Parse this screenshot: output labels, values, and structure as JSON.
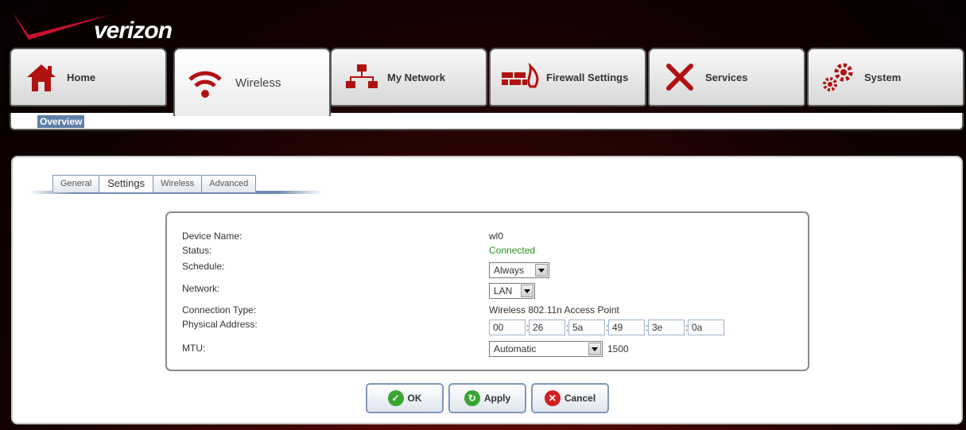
{
  "brand": {
    "logo_text": "verizon"
  },
  "main_tabs": [
    {
      "label": "Home",
      "icon": "home-icon"
    },
    {
      "label": "Wireless",
      "icon": "wifi-icon"
    },
    {
      "label": "My Network",
      "icon": "network-icon"
    },
    {
      "label": "Firewall Settings",
      "icon": "firewall-icon"
    },
    {
      "label": "Services",
      "icon": "tools-icon"
    },
    {
      "label": "System",
      "icon": "gears-icon"
    }
  ],
  "subnav": {
    "overview": "Overview"
  },
  "sub_tabs": [
    "General",
    "Settings",
    "Wireless",
    "Advanced"
  ],
  "form": {
    "device_name": {
      "label": "Device Name:",
      "value": "wl0"
    },
    "status": {
      "label": "Status:",
      "value": "Connected"
    },
    "schedule": {
      "label": "Schedule:",
      "value": "Always"
    },
    "network": {
      "label": "Network:",
      "value": "LAN"
    },
    "connection_type": {
      "label": "Connection Type:",
      "value": "Wireless 802.11n Access Point"
    },
    "physical_address": {
      "label": "Physical Address:",
      "octets": [
        "00",
        "26",
        "5a",
        "49",
        "3e",
        "0a"
      ]
    },
    "mtu": {
      "label": "MTU:",
      "mode": "Automatic",
      "value": "1500"
    }
  },
  "buttons": {
    "ok": "OK",
    "apply": "Apply",
    "cancel": "Cancel"
  },
  "colors": {
    "accent_blue": "#5f7fa8",
    "status_green": "#2a8f1e",
    "brand_red": "#c8102e"
  }
}
